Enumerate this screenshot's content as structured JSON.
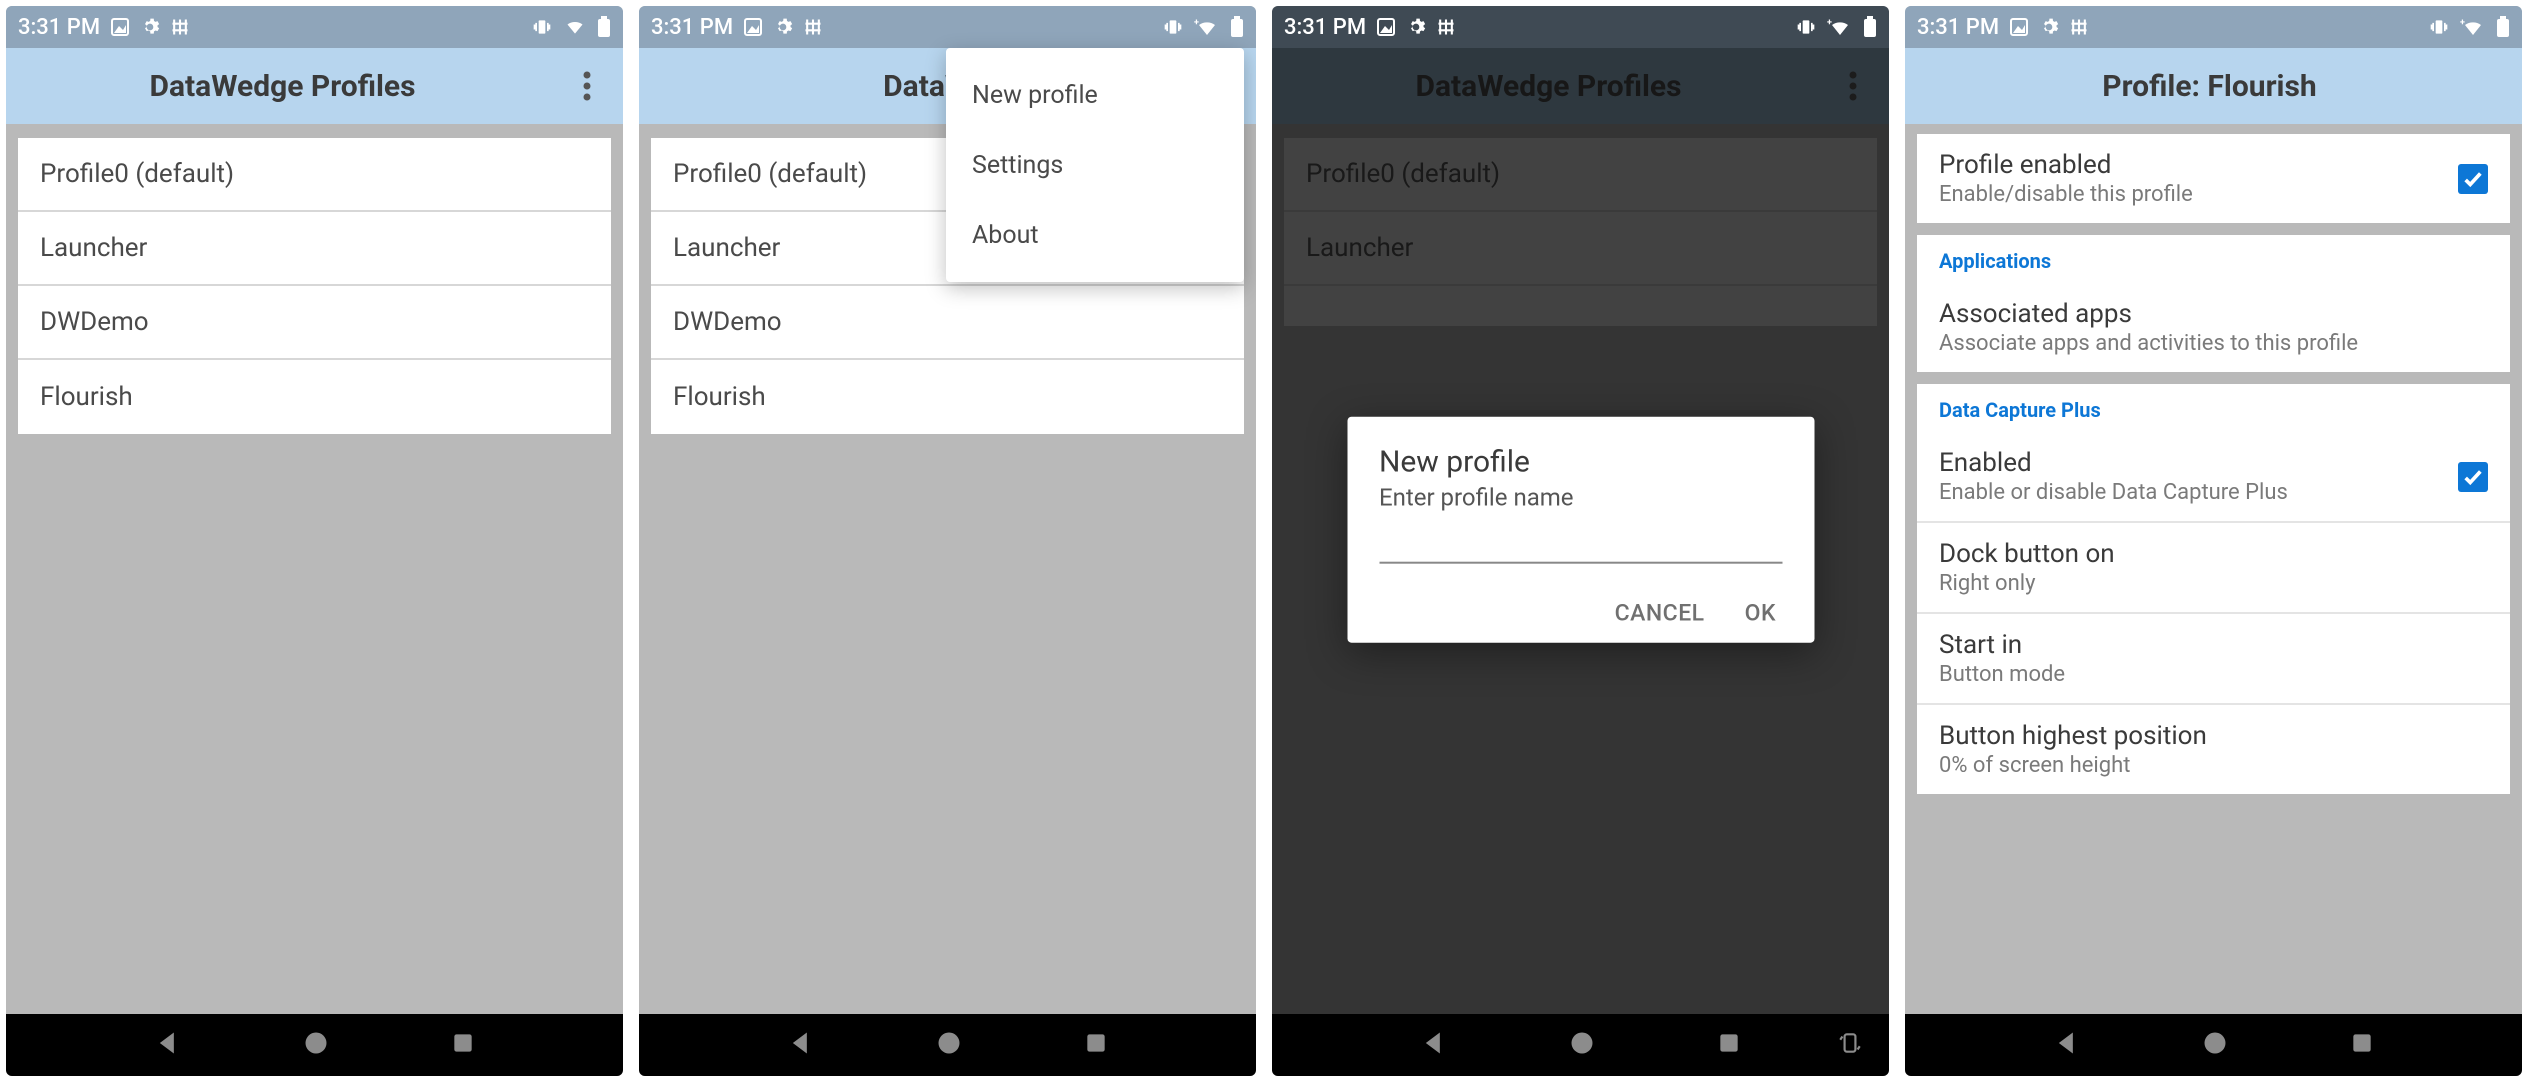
{
  "status_bar": {
    "time": "3:31 PM"
  },
  "screen1": {
    "title": "DataWedge Profiles",
    "profiles": [
      "Profile0 (default)",
      "Launcher",
      "DWDemo",
      "Flourish"
    ]
  },
  "screen2": {
    "title_visible": "DataWed",
    "profiles": [
      "Profile0 (default)",
      "Launcher",
      "DWDemo",
      "Flourish"
    ],
    "menu": [
      "New profile",
      "Settings",
      "About"
    ]
  },
  "screen3": {
    "title": "DataWedge Profiles",
    "profiles": [
      "Profile0 (default)",
      "Launcher"
    ],
    "dialog": {
      "title": "New profile",
      "subtitle": "Enter profile name",
      "cancel": "CANCEL",
      "ok": "OK"
    }
  },
  "screen4": {
    "title": "Profile: Flourish",
    "profile_enabled": {
      "title": "Profile enabled",
      "sub": "Enable/disable this profile",
      "checked": true
    },
    "section_apps": "Applications",
    "associated_apps": {
      "title": "Associated apps",
      "sub": "Associate apps and activities to this profile"
    },
    "section_dcp": "Data Capture Plus",
    "dcp_enabled": {
      "title": "Enabled",
      "sub": "Enable or disable Data Capture Plus",
      "checked": true
    },
    "dock_button": {
      "title": "Dock button on",
      "sub": "Right only"
    },
    "start_in": {
      "title": "Start in",
      "sub": "Button mode"
    },
    "highest_pos": {
      "title": "Button highest position",
      "sub": "0% of screen height"
    }
  }
}
